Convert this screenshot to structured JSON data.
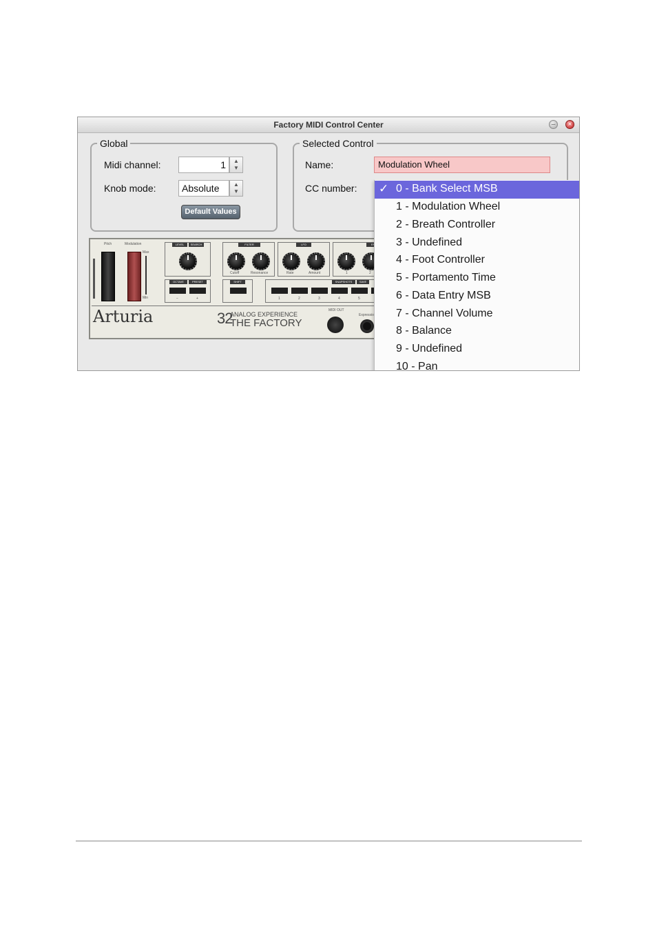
{
  "window": {
    "title": "Factory MIDI Control Center"
  },
  "global": {
    "legend": "Global",
    "midi_channel_label": "Midi channel:",
    "midi_channel_value": "1",
    "knob_mode_label": "Knob mode:",
    "knob_mode_value": "Absolute",
    "default_values_label": "Default Values"
  },
  "selected_control": {
    "legend": "Selected Control",
    "name_label": "Name:",
    "name_value": "Modulation Wheel",
    "cc_label": "CC number:"
  },
  "device": {
    "brand": "Arturia",
    "model_number": "32",
    "model_line1": "ANALOG EXPERIENCE",
    "model_line2": "THE FACTORY",
    "labels": {
      "pitch": "Pitch",
      "modulation": "Modulation",
      "max": "Max",
      "min": "Min",
      "level": "LEVEL",
      "search": "SEARCH",
      "filter": "FILTER",
      "lfo": "LFO",
      "env": "ENV",
      "octave": "OCTAVE",
      "preset": "PRESET",
      "shift": "SHIFT",
      "snapshots": "SNAPSHOTS",
      "save": "SAVE",
      "cutoff": "Cutoff",
      "resonance": "Resonance",
      "rate": "Rate",
      "amount": "Amount",
      "one": "1",
      "two": "2",
      "minus": "−",
      "plus": "+",
      "s1": "1",
      "s2": "2",
      "s3": "3",
      "s4": "4",
      "s5": "5",
      "midi_out": "MIDI OUT",
      "expression": "Expression"
    }
  },
  "cc_dropdown": {
    "options": [
      "0 - Bank Select MSB",
      "1 - Modulation Wheel",
      "2 - Breath Controller",
      "3 - Undefined",
      "4 - Foot Controller",
      "5 - Portamento Time",
      "6 - Data Entry MSB",
      "7 - Channel Volume",
      "8 - Balance",
      "9 - Undefined",
      "10 - Pan"
    ],
    "check_mark": "✓"
  },
  "colors": {
    "selection": "#6b66dc",
    "name_field_bg": "#f8c8c8",
    "mod_wheel": "#9b3a3a"
  }
}
